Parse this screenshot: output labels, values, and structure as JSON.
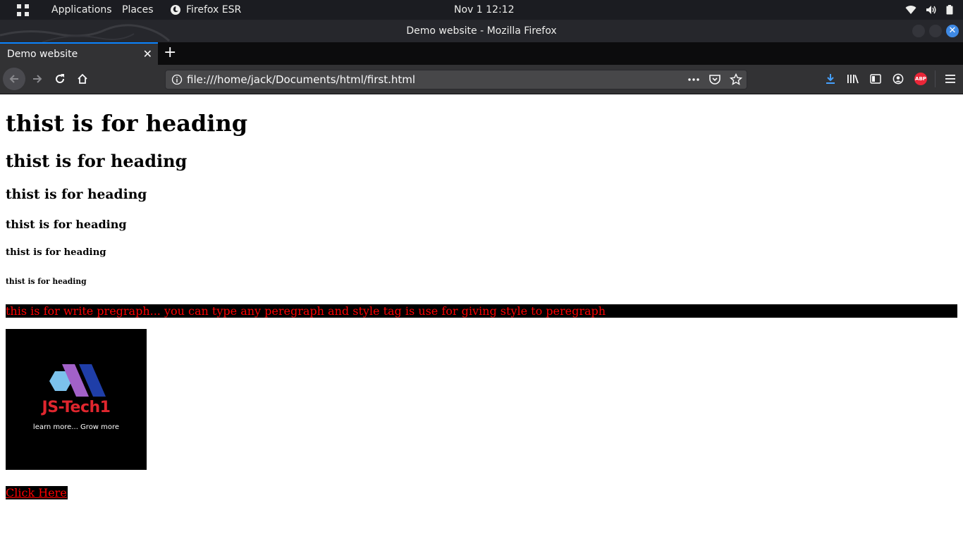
{
  "topbar": {
    "applications": "Applications",
    "places": "Places",
    "firefox": "Firefox ESR",
    "clock": "Nov 1  12:12"
  },
  "window": {
    "title": "Demo website - Mozilla Firefox"
  },
  "tabs": [
    {
      "label": "Demo website"
    }
  ],
  "urlbar": {
    "url": "file:///home/jack/Documents/html/first.html"
  },
  "toolbar": {
    "abp_label": "ABP"
  },
  "page": {
    "headings": {
      "h1": "thist is for heading",
      "h2": "thist is for heading",
      "h3": "thist is for heading",
      "h4": "thist is for heading",
      "h5": "thist is for heading",
      "h6": "thist is for heading"
    },
    "paragraph": "this is for write pregraph... you can type any peregraph and style tag is use for giving style to peregraph",
    "logo": {
      "title": "JS-Tech1",
      "tagline": "learn more... Grow more"
    },
    "link": "Click Here"
  },
  "colors": {
    "accent": "#0a84ff",
    "paragraph_text": "#ff0000",
    "paragraph_bg": "#000000",
    "logo_red": "#e0262e"
  }
}
